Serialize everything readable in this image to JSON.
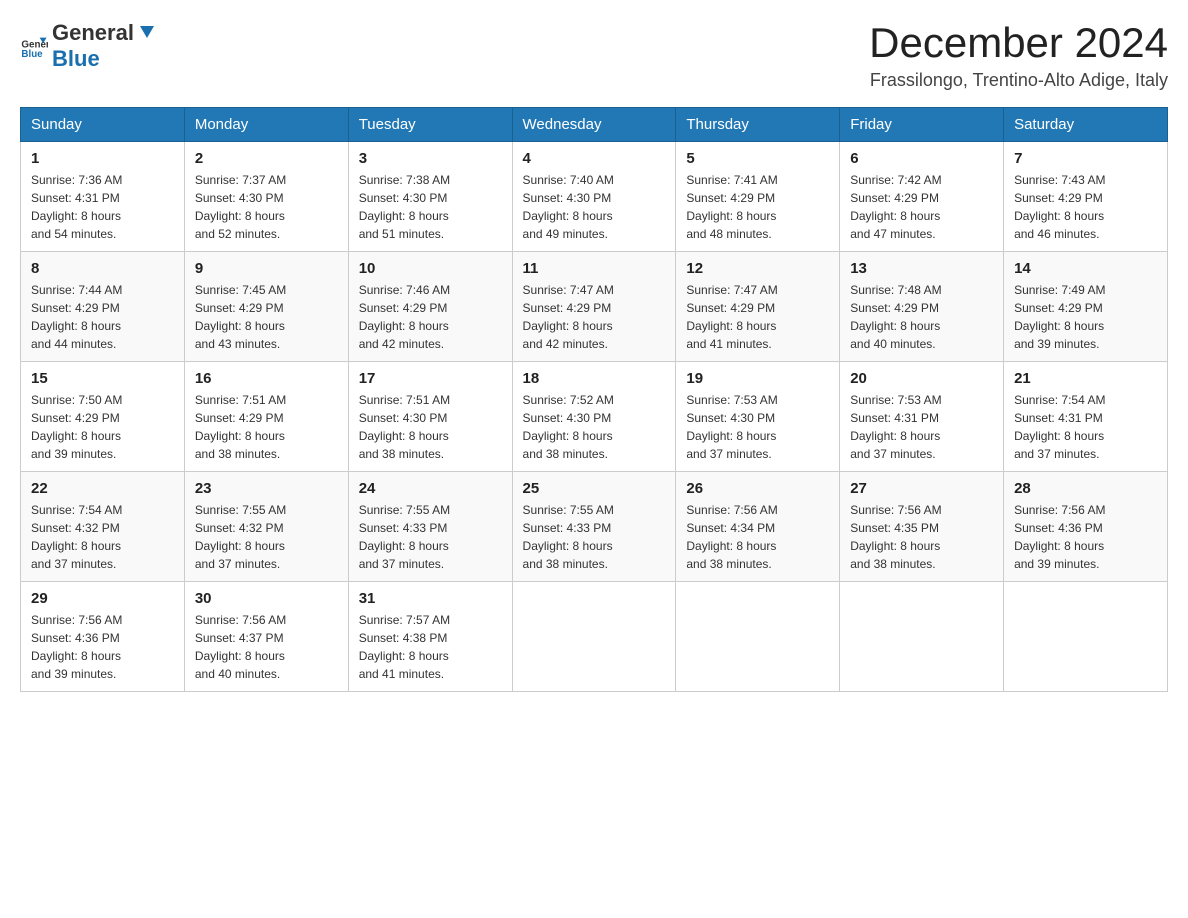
{
  "header": {
    "logo_general": "General",
    "logo_blue": "Blue",
    "month_title": "December 2024",
    "location": "Frassilongo, Trentino-Alto Adige, Italy"
  },
  "days_of_week": [
    "Sunday",
    "Monday",
    "Tuesday",
    "Wednesday",
    "Thursday",
    "Friday",
    "Saturday"
  ],
  "weeks": [
    [
      {
        "day": "1",
        "sunrise": "7:36 AM",
        "sunset": "4:31 PM",
        "daylight": "8 hours and 54 minutes."
      },
      {
        "day": "2",
        "sunrise": "7:37 AM",
        "sunset": "4:30 PM",
        "daylight": "8 hours and 52 minutes."
      },
      {
        "day": "3",
        "sunrise": "7:38 AM",
        "sunset": "4:30 PM",
        "daylight": "8 hours and 51 minutes."
      },
      {
        "day": "4",
        "sunrise": "7:40 AM",
        "sunset": "4:30 PM",
        "daylight": "8 hours and 49 minutes."
      },
      {
        "day": "5",
        "sunrise": "7:41 AM",
        "sunset": "4:29 PM",
        "daylight": "8 hours and 48 minutes."
      },
      {
        "day": "6",
        "sunrise": "7:42 AM",
        "sunset": "4:29 PM",
        "daylight": "8 hours and 47 minutes."
      },
      {
        "day": "7",
        "sunrise": "7:43 AM",
        "sunset": "4:29 PM",
        "daylight": "8 hours and 46 minutes."
      }
    ],
    [
      {
        "day": "8",
        "sunrise": "7:44 AM",
        "sunset": "4:29 PM",
        "daylight": "8 hours and 44 minutes."
      },
      {
        "day": "9",
        "sunrise": "7:45 AM",
        "sunset": "4:29 PM",
        "daylight": "8 hours and 43 minutes."
      },
      {
        "day": "10",
        "sunrise": "7:46 AM",
        "sunset": "4:29 PM",
        "daylight": "8 hours and 42 minutes."
      },
      {
        "day": "11",
        "sunrise": "7:47 AM",
        "sunset": "4:29 PM",
        "daylight": "8 hours and 42 minutes."
      },
      {
        "day": "12",
        "sunrise": "7:47 AM",
        "sunset": "4:29 PM",
        "daylight": "8 hours and 41 minutes."
      },
      {
        "day": "13",
        "sunrise": "7:48 AM",
        "sunset": "4:29 PM",
        "daylight": "8 hours and 40 minutes."
      },
      {
        "day": "14",
        "sunrise": "7:49 AM",
        "sunset": "4:29 PM",
        "daylight": "8 hours and 39 minutes."
      }
    ],
    [
      {
        "day": "15",
        "sunrise": "7:50 AM",
        "sunset": "4:29 PM",
        "daylight": "8 hours and 39 minutes."
      },
      {
        "day": "16",
        "sunrise": "7:51 AM",
        "sunset": "4:29 PM",
        "daylight": "8 hours and 38 minutes."
      },
      {
        "day": "17",
        "sunrise": "7:51 AM",
        "sunset": "4:30 PM",
        "daylight": "8 hours and 38 minutes."
      },
      {
        "day": "18",
        "sunrise": "7:52 AM",
        "sunset": "4:30 PM",
        "daylight": "8 hours and 38 minutes."
      },
      {
        "day": "19",
        "sunrise": "7:53 AM",
        "sunset": "4:30 PM",
        "daylight": "8 hours and 37 minutes."
      },
      {
        "day": "20",
        "sunrise": "7:53 AM",
        "sunset": "4:31 PM",
        "daylight": "8 hours and 37 minutes."
      },
      {
        "day": "21",
        "sunrise": "7:54 AM",
        "sunset": "4:31 PM",
        "daylight": "8 hours and 37 minutes."
      }
    ],
    [
      {
        "day": "22",
        "sunrise": "7:54 AM",
        "sunset": "4:32 PM",
        "daylight": "8 hours and 37 minutes."
      },
      {
        "day": "23",
        "sunrise": "7:55 AM",
        "sunset": "4:32 PM",
        "daylight": "8 hours and 37 minutes."
      },
      {
        "day": "24",
        "sunrise": "7:55 AM",
        "sunset": "4:33 PM",
        "daylight": "8 hours and 37 minutes."
      },
      {
        "day": "25",
        "sunrise": "7:55 AM",
        "sunset": "4:33 PM",
        "daylight": "8 hours and 38 minutes."
      },
      {
        "day": "26",
        "sunrise": "7:56 AM",
        "sunset": "4:34 PM",
        "daylight": "8 hours and 38 minutes."
      },
      {
        "day": "27",
        "sunrise": "7:56 AM",
        "sunset": "4:35 PM",
        "daylight": "8 hours and 38 minutes."
      },
      {
        "day": "28",
        "sunrise": "7:56 AM",
        "sunset": "4:36 PM",
        "daylight": "8 hours and 39 minutes."
      }
    ],
    [
      {
        "day": "29",
        "sunrise": "7:56 AM",
        "sunset": "4:36 PM",
        "daylight": "8 hours and 39 minutes."
      },
      {
        "day": "30",
        "sunrise": "7:56 AM",
        "sunset": "4:37 PM",
        "daylight": "8 hours and 40 minutes."
      },
      {
        "day": "31",
        "sunrise": "7:57 AM",
        "sunset": "4:38 PM",
        "daylight": "8 hours and 41 minutes."
      },
      null,
      null,
      null,
      null
    ]
  ],
  "labels": {
    "sunrise": "Sunrise:",
    "sunset": "Sunset:",
    "daylight": "Daylight:"
  }
}
